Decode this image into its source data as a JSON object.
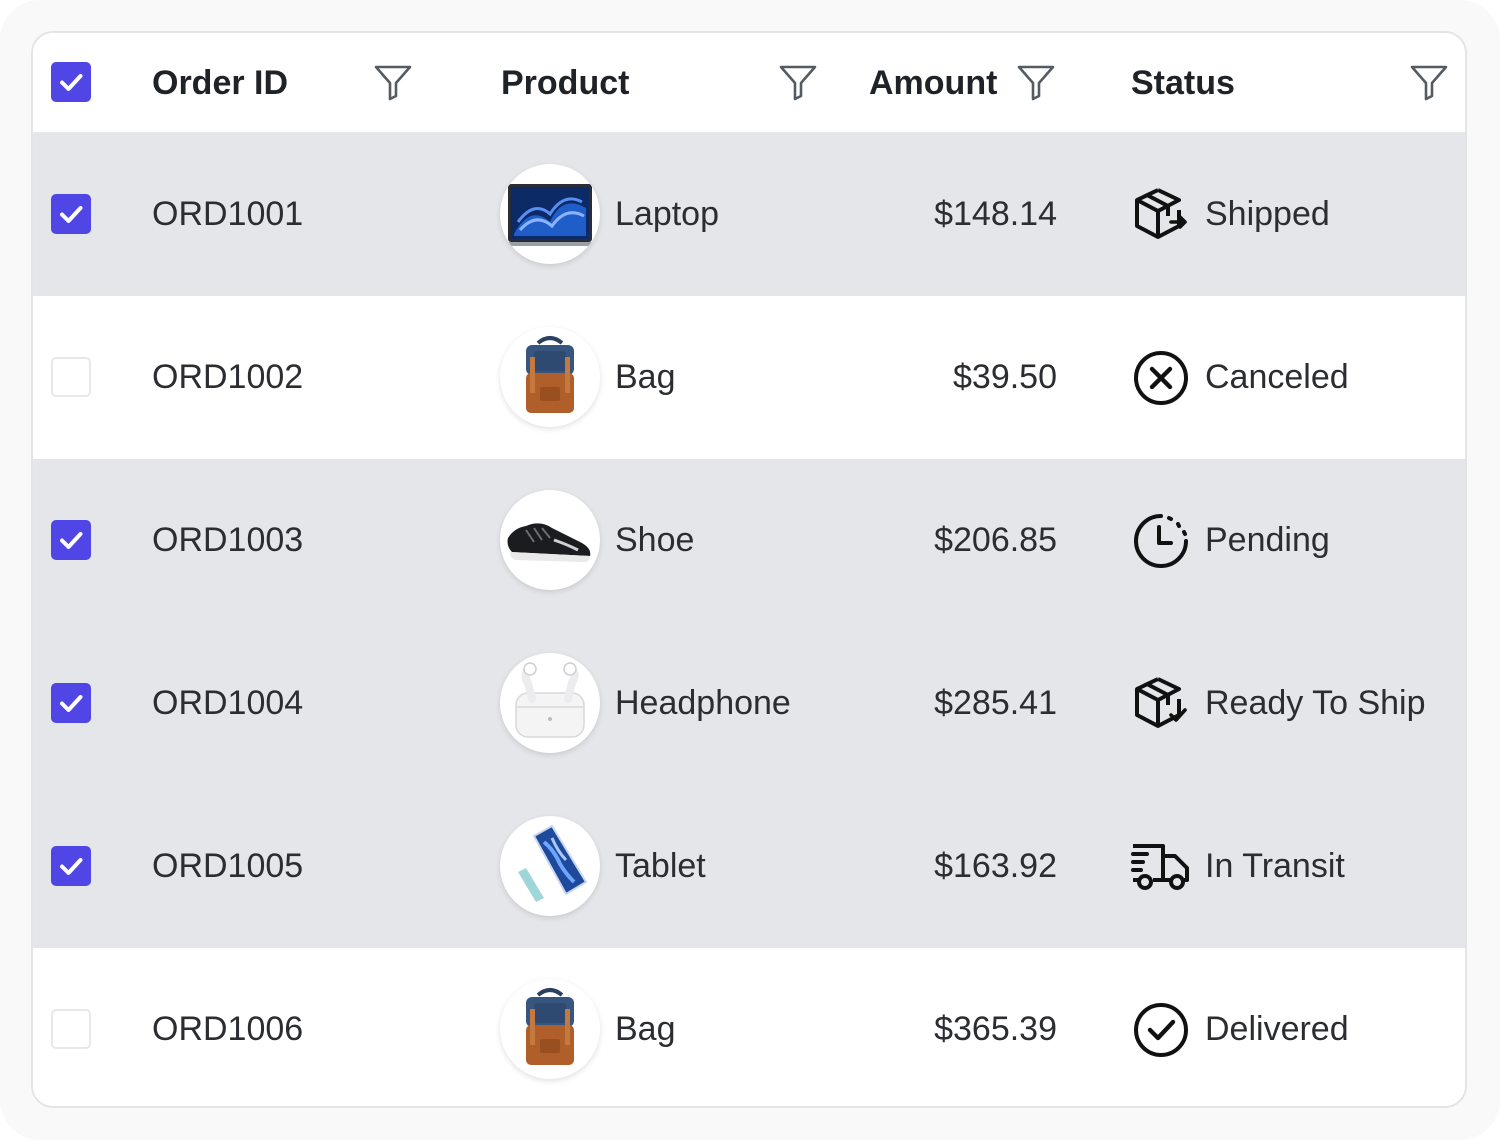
{
  "header": {
    "select_all_checked": true,
    "columns": [
      {
        "label": "Order ID"
      },
      {
        "label": "Product"
      },
      {
        "label": "Amount"
      },
      {
        "label": "Status"
      }
    ]
  },
  "rows": [
    {
      "selected": true,
      "order_id": "ORD1001",
      "product": "Laptop",
      "product_image": "laptop-image",
      "amount": "$148.14",
      "status": "Shipped",
      "status_icon": "package-shipped-icon"
    },
    {
      "selected": false,
      "order_id": "ORD1002",
      "product": "Bag",
      "product_image": "backpack-image",
      "amount": "$39.50",
      "status": "Canceled",
      "status_icon": "x-circle-icon"
    },
    {
      "selected": true,
      "order_id": "ORD1003",
      "product": "Shoe",
      "product_image": "sneaker-image",
      "amount": "$206.85",
      "status": "Pending",
      "status_icon": "clock-pending-icon"
    },
    {
      "selected": true,
      "order_id": "ORD1004",
      "product": "Headphone",
      "product_image": "earbuds-image",
      "amount": "$285.41",
      "status": "Ready To Ship",
      "status_icon": "package-check-icon"
    },
    {
      "selected": true,
      "order_id": "ORD1005",
      "product": "Tablet",
      "product_image": "tablet-image",
      "amount": "$163.92",
      "status": "In Transit",
      "status_icon": "truck-icon"
    },
    {
      "selected": false,
      "order_id": "ORD1006",
      "product": "Bag",
      "product_image": "backpack-image",
      "amount": "$365.39",
      "status": "Delivered",
      "status_icon": "check-circle-icon"
    }
  ],
  "colors": {
    "accent": "#4f46e5",
    "selected_row_bg": "#e5e6ea",
    "text": "#2b2d31"
  }
}
